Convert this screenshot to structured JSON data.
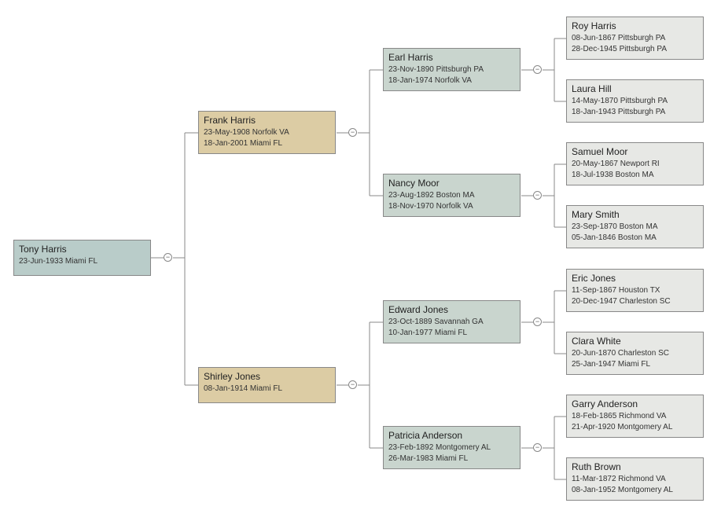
{
  "root": {
    "name": "Tony Harris",
    "line1": "23-Jun-1933 Miami FL"
  },
  "gen1": {
    "father": {
      "name": "Frank Harris",
      "line1": "23-May-1908 Norfolk VA",
      "line2": "18-Jan-2001 Miami FL"
    },
    "mother": {
      "name": "Shirley Jones",
      "line1": "08-Jan-1914 Miami FL"
    }
  },
  "gen2": {
    "pp": {
      "name": "Earl Harris",
      "line1": "23-Nov-1890 Pittsburgh PA",
      "line2": "18-Jan-1974 Norfolk VA"
    },
    "pm": {
      "name": "Nancy Moor",
      "line1": "23-Aug-1892 Boston MA",
      "line2": "18-Nov-1970 Norfolk VA"
    },
    "mp": {
      "name": "Edward Jones",
      "line1": "23-Oct-1889 Savannah GA",
      "line2": "10-Jan-1977 Miami FL"
    },
    "mm": {
      "name": "Patricia Anderson",
      "line1": "23-Feb-1892 Montgomery AL",
      "line2": "26-Mar-1983 Miami FL"
    }
  },
  "gen3": {
    "ppp": {
      "name": "Roy Harris",
      "line1": "08-Jun-1867 Pittsburgh PA",
      "line2": "28-Dec-1945 Pittsburgh PA"
    },
    "ppm": {
      "name": "Laura Hill",
      "line1": "14-May-1870 Pittsburgh PA",
      "line2": "18-Jan-1943 Pittsburgh PA"
    },
    "pmp": {
      "name": "Samuel Moor",
      "line1": "20-May-1867 Newport RI",
      "line2": "18-Jul-1938 Boston MA"
    },
    "pmm": {
      "name": "Mary Smith",
      "line1": "23-Sep-1870 Boston MA",
      "line2": "05-Jan-1846 Boston MA"
    },
    "mpp": {
      "name": "Eric Jones",
      "line1": "11-Sep-1867  Houston TX",
      "line2": "20-Dec-1947 Charleston SC"
    },
    "mpm": {
      "name": "Clara White",
      "line1": "20-Jun-1870 Charleston SC",
      "line2": "25-Jan-1947 Miami FL"
    },
    "mmp": {
      "name": "Garry Anderson",
      "line1": "18-Feb-1865 Richmond VA",
      "line2": "21-Apr-1920 Montgomery AL"
    },
    "mmm": {
      "name": "Ruth Brown",
      "line1": "11-Mar-1872 Richmond VA",
      "line2": "08-Jan-1952 Montgomery AL"
    }
  }
}
